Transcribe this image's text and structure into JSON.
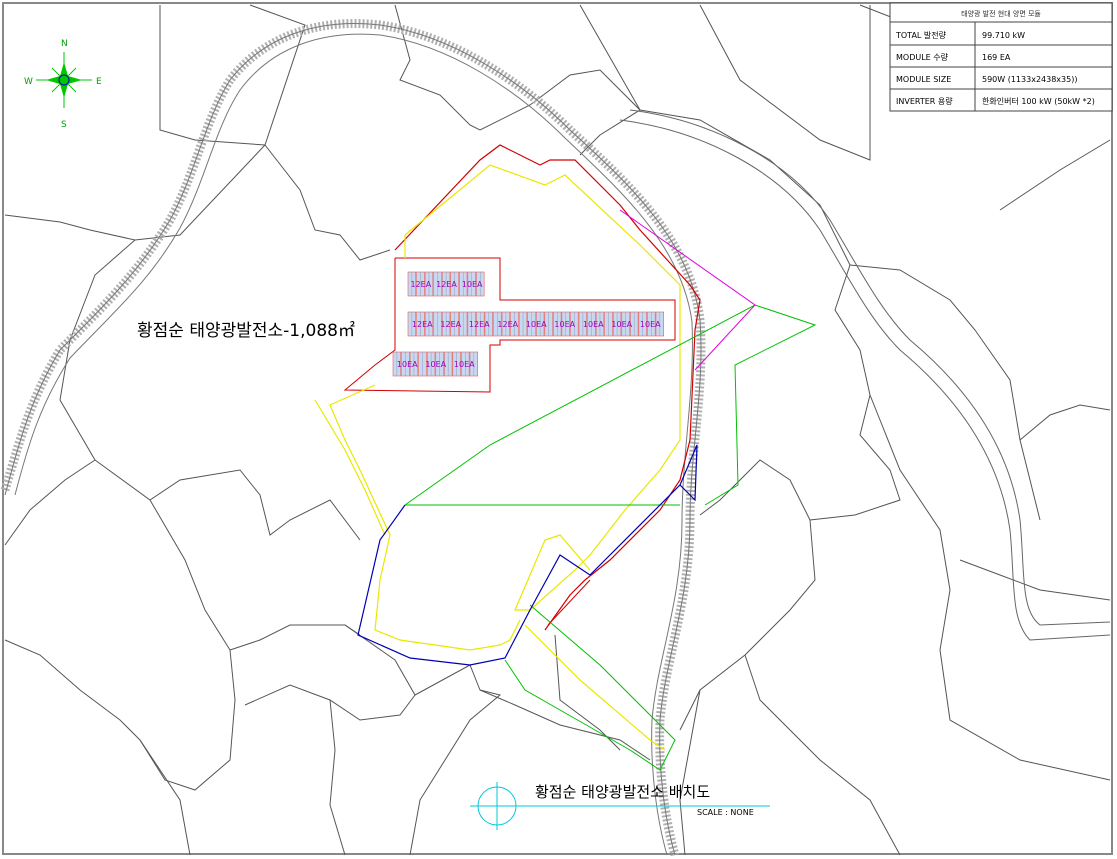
{
  "info_table": {
    "title": "태양광 발전 현대 양면 모듈",
    "rows": [
      {
        "label": "TOTAL 발전량",
        "value": "99.710 kW"
      },
      {
        "label": "MODULE 수량",
        "value": "169 EA"
      },
      {
        "label": "MODULE SIZE",
        "value": "590W (1133x2438x35))"
      },
      {
        "label": "INVERTER 용량",
        "value": "한화인버터 100 kW (50kW *2)"
      }
    ]
  },
  "compass": {
    "n": "N",
    "s": "S",
    "e": "E",
    "w": "W"
  },
  "site_label": "황점순 태양광발전소-1,088㎡",
  "drawing_title": "황점순 태양광발전소 배치도",
  "scale_text": "SCALE : NONE",
  "array_rows": [
    {
      "tags": [
        "12EA",
        "12EA",
        "10EA"
      ],
      "panels": 9
    },
    {
      "tags": [
        "12EA",
        "12EA",
        "12EA",
        "12EA",
        "10EA",
        "10EA",
        "10EA",
        "10EA",
        "10EA"
      ],
      "panels": 30
    },
    {
      "tags": [
        "10EA",
        "10EA",
        "10EA"
      ],
      "panels": 10
    }
  ],
  "colors": {
    "boundary_red": "#d00000",
    "setback_yellow": "#e8e800",
    "lot_green": "#00c000",
    "lot_blue": "#0000b0",
    "lot_magenta": "#e000e0",
    "compass_green": "#00c800",
    "cyan": "#00c8d8",
    "panel_fill": "#c8d8f0",
    "panel_outline": "#e06060",
    "tag_color": "#a000c0"
  }
}
